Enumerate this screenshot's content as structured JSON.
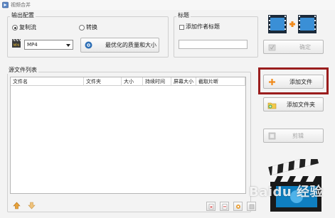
{
  "window": {
    "title": "视频合并"
  },
  "output_group": {
    "label": "输出配置",
    "radio_copy_stream": "复制流",
    "radio_convert": "转换",
    "format_selected": "MP4",
    "quality_button": "最优化的质量和大小"
  },
  "title_group": {
    "label": "标题",
    "add_subtitle_checkbox": "添加作者标题",
    "title_value": ""
  },
  "confirm_button": "确定",
  "source_group": {
    "label": "源文件列表",
    "columns": [
      "文件名",
      "文件夹",
      "大小",
      "持续时间",
      "屏幕大小",
      "截取片断"
    ]
  },
  "add_file_button": "添加文件",
  "add_folder_button": "添加文件夹",
  "edit_button": "剪辑",
  "watermark": "Baidu 经验"
}
